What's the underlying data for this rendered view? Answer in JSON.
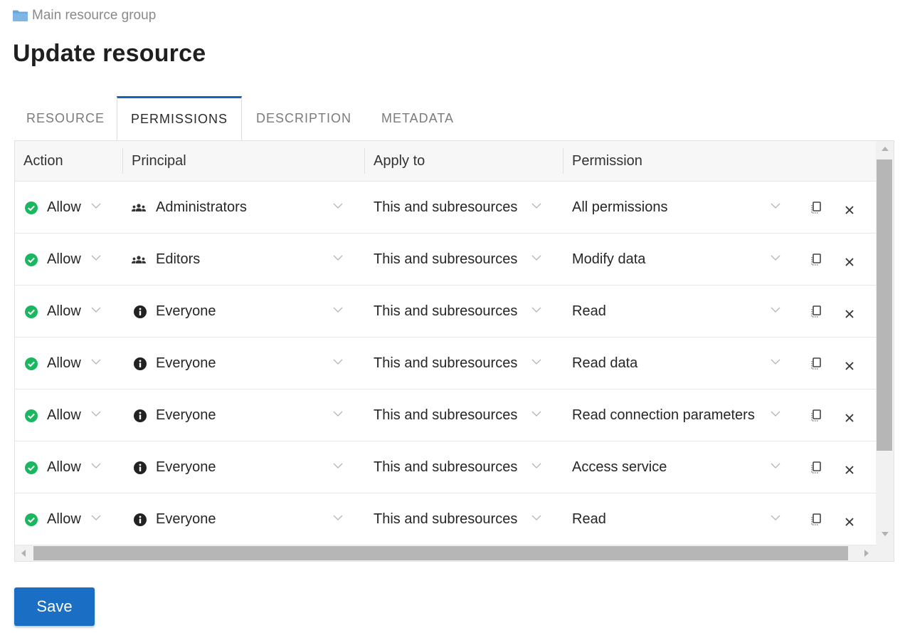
{
  "breadcrumb": {
    "label": "Main resource group",
    "icon": "folder-icon"
  },
  "page_title": "Update resource",
  "tabs": [
    {
      "label": "RESOURCE",
      "active": false
    },
    {
      "label": "PERMISSIONS",
      "active": true
    },
    {
      "label": "DESCRIPTION",
      "active": false
    },
    {
      "label": "METADATA",
      "active": false
    }
  ],
  "table": {
    "headers": {
      "action": "Action",
      "principal": "Principal",
      "apply_to": "Apply to",
      "permission": "Permission"
    },
    "rows": [
      {
        "action": "Allow",
        "principal": "Administrators",
        "principal_icon": "group-icon",
        "apply_to": "This and subresources",
        "permission": "All permissions"
      },
      {
        "action": "Allow",
        "principal": "Editors",
        "principal_icon": "group-icon",
        "apply_to": "This and subresources",
        "permission": "Modify data"
      },
      {
        "action": "Allow",
        "principal": "Everyone",
        "principal_icon": "info-icon",
        "apply_to": "This and subresources",
        "permission": "Read"
      },
      {
        "action": "Allow",
        "principal": "Everyone",
        "principal_icon": "info-icon",
        "apply_to": "This and subresources",
        "permission": "Read data"
      },
      {
        "action": "Allow",
        "principal": "Everyone",
        "principal_icon": "info-icon",
        "apply_to": "This and subresources",
        "permission": "Read connection parameters"
      },
      {
        "action": "Allow",
        "principal": "Everyone",
        "principal_icon": "info-icon",
        "apply_to": "This and subresources",
        "permission": "Access service"
      },
      {
        "action": "Allow",
        "principal": "Everyone",
        "principal_icon": "info-icon",
        "apply_to": "This and subresources",
        "permission": "Read"
      }
    ]
  },
  "save_label": "Save",
  "colors": {
    "accent": "#1a6fc4",
    "allow_green": "#1ab760",
    "tab_indicator": "#1565c0"
  }
}
